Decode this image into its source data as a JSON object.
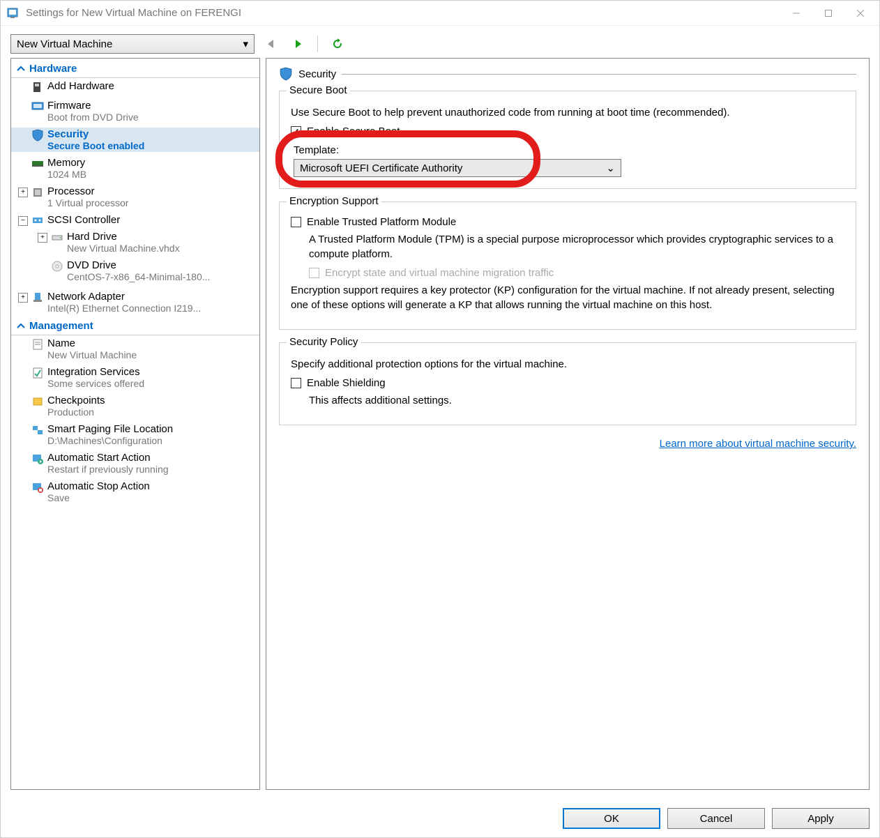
{
  "window": {
    "title": "Settings for New Virtual Machine on FERENGI"
  },
  "vm_selector": {
    "value": "New Virtual Machine"
  },
  "sidebar": {
    "sections": [
      {
        "title": "Hardware"
      },
      {
        "title": "Management"
      }
    ],
    "hardware": [
      {
        "label": "Add Hardware",
        "sub": ""
      },
      {
        "label": "Firmware",
        "sub": "Boot from DVD Drive"
      },
      {
        "label": "Security",
        "sub": "Secure Boot enabled"
      },
      {
        "label": "Memory",
        "sub": "1024 MB"
      },
      {
        "label": "Processor",
        "sub": "1 Virtual processor"
      },
      {
        "label": "SCSI Controller",
        "sub": "",
        "children": [
          {
            "label": "Hard Drive",
            "sub": "New Virtual Machine.vhdx"
          },
          {
            "label": "DVD Drive",
            "sub": "CentOS-7-x86_64-Minimal-180..."
          }
        ]
      },
      {
        "label": "Network Adapter",
        "sub": "Intel(R) Ethernet Connection I219..."
      }
    ],
    "management": [
      {
        "label": "Name",
        "sub": "New Virtual Machine"
      },
      {
        "label": "Integration Services",
        "sub": "Some services offered"
      },
      {
        "label": "Checkpoints",
        "sub": "Production"
      },
      {
        "label": "Smart Paging File Location",
        "sub": "D:\\Machines\\Configuration"
      },
      {
        "label": "Automatic Start Action",
        "sub": "Restart if previously running"
      },
      {
        "label": "Automatic Stop Action",
        "sub": "Save"
      }
    ]
  },
  "panel": {
    "title": "Security",
    "secure_boot": {
      "legend": "Secure Boot",
      "desc": "Use Secure Boot to help prevent unauthorized code from running at boot time (recommended).",
      "enable_label": "Enable Secure Boot",
      "template_label": "Template:",
      "template_value": "Microsoft UEFI Certificate Authority"
    },
    "encryption": {
      "legend": "Encryption Support",
      "tpm_label": "Enable Trusted Platform Module",
      "tpm_desc": "A Trusted Platform Module (TPM) is a special purpose microprocessor which provides cryptographic services to a compute platform.",
      "encrypt_traffic_label": "Encrypt state and virtual machine migration traffic",
      "kp_desc": "Encryption support requires a key protector (KP) configuration for the virtual machine. If not already present, selecting one of these options will generate a KP that allows running the virtual machine on this host."
    },
    "policy": {
      "legend": "Security Policy",
      "desc": "Specify additional protection options for the virtual machine.",
      "shielding_label": "Enable Shielding",
      "shielding_desc": "This affects additional settings."
    },
    "link": "Learn more about virtual machine security."
  },
  "buttons": {
    "ok": "OK",
    "cancel": "Cancel",
    "apply": "Apply"
  }
}
